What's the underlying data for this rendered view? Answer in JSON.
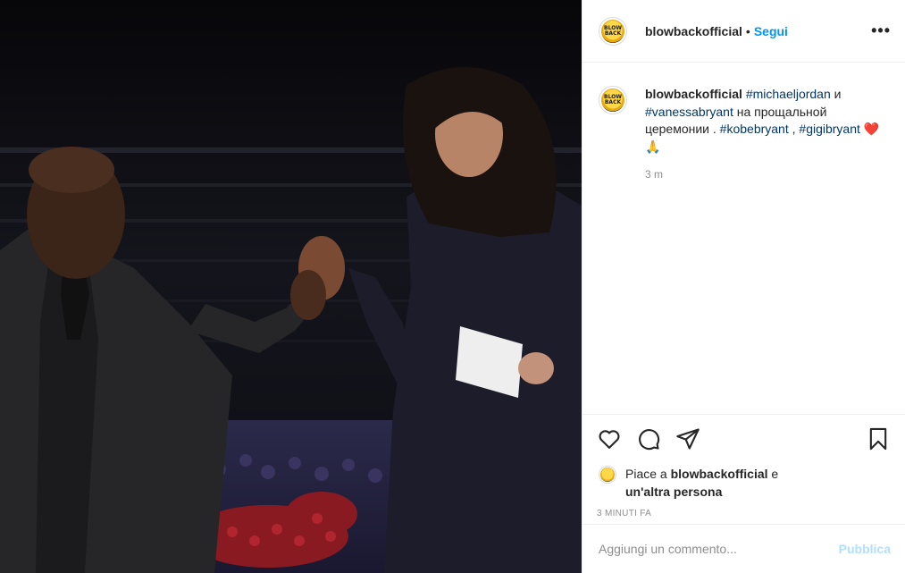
{
  "post": {
    "username": "blowbackofficial",
    "separator": "•",
    "follow_label": "Segui",
    "more_icon": "more-horizontal-icon",
    "avatar_text": "BLOW BACK"
  },
  "caption": {
    "username": "blowbackofficial",
    "tag1": "#michaeljordan",
    "text1": " и ",
    "tag2": "#vanessabryant",
    "text2": " на прощальной церемонии . ",
    "tag3": "#kobebryant",
    "text3": " , ",
    "tag4": "#gigibryant",
    "emoji": " ❤️🙏",
    "time": "3 m"
  },
  "actions": {
    "like_icon": "heart-icon",
    "comment_icon": "comment-icon",
    "share_icon": "paper-plane-icon",
    "save_icon": "bookmark-icon"
  },
  "likes": {
    "prefix": "Piace a ",
    "user": "blowbackofficial",
    "middle": " e ",
    "others": "un'altra persona"
  },
  "timestamp": "3 MINUTI FA",
  "comment_box": {
    "placeholder": "Aggiungi un commento...",
    "publish_label": "Pubblica"
  },
  "colors": {
    "link": "#0095f6",
    "hashtag": "#00376b",
    "muted": "#8e8e8e",
    "publish_disabled": "#b2dffc"
  }
}
